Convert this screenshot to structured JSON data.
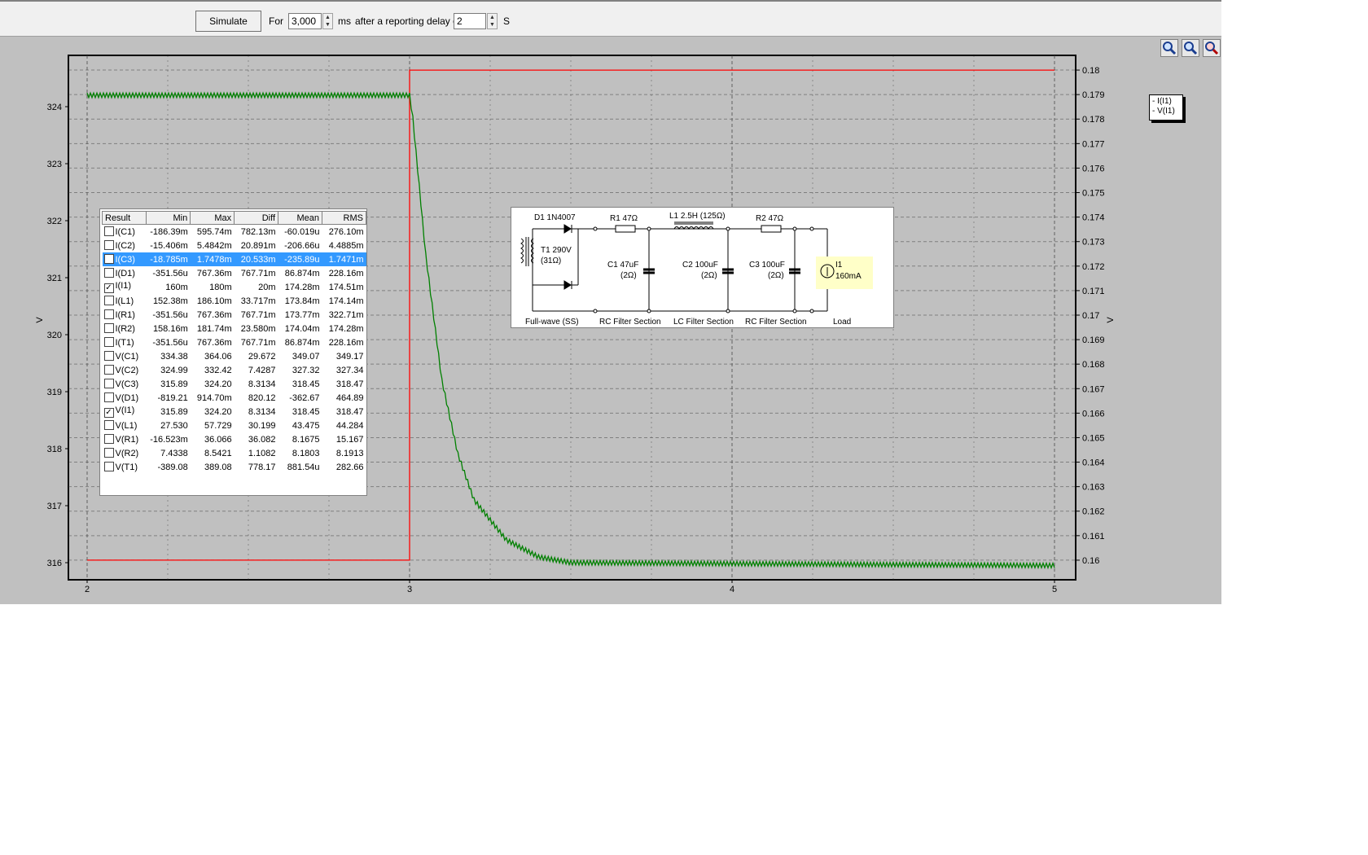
{
  "toolbar": {
    "simulate_label": "Simulate",
    "for_label": "For",
    "duration_value": "3,000",
    "ms_label": "ms",
    "delay_label": "after a reporting delay of",
    "delay_value": "2",
    "s_label": "S"
  },
  "zoom_icons": [
    "zoom-in-icon",
    "zoom-out-icon",
    "zoom-fit-icon"
  ],
  "legend": {
    "items": [
      "- I(I1)",
      "- V(I1)"
    ]
  },
  "table": {
    "headers": [
      "Result",
      "Min",
      "Max",
      "Diff",
      "Mean",
      "RMS"
    ],
    "rows": [
      {
        "name": "I(C1)",
        "checked": false,
        "selected": false,
        "min": "-186.39m",
        "max": "595.74m",
        "diff": "782.13m",
        "mean": "-60.019u",
        "rms": "276.10m"
      },
      {
        "name": "I(C2)",
        "checked": false,
        "selected": false,
        "min": "-15.406m",
        "max": "5.4842m",
        "diff": "20.891m",
        "mean": "-206.66u",
        "rms": "4.4885m"
      },
      {
        "name": "I(C3)",
        "checked": false,
        "selected": true,
        "min": "-18.785m",
        "max": "1.7478m",
        "diff": "20.533m",
        "mean": "-235.89u",
        "rms": "1.7471m"
      },
      {
        "name": "I(D1)",
        "checked": false,
        "selected": false,
        "min": "-351.56u",
        "max": "767.36m",
        "diff": "767.71m",
        "mean": "86.874m",
        "rms": "228.16m"
      },
      {
        "name": "I(I1)",
        "checked": true,
        "selected": false,
        "min": "160m",
        "max": "180m",
        "diff": "20m",
        "mean": "174.28m",
        "rms": "174.51m"
      },
      {
        "name": "I(L1)",
        "checked": false,
        "selected": false,
        "min": "152.38m",
        "max": "186.10m",
        "diff": "33.717m",
        "mean": "173.84m",
        "rms": "174.14m"
      },
      {
        "name": "I(R1)",
        "checked": false,
        "selected": false,
        "min": "-351.56u",
        "max": "767.36m",
        "diff": "767.71m",
        "mean": "173.77m",
        "rms": "322.71m"
      },
      {
        "name": "I(R2)",
        "checked": false,
        "selected": false,
        "min": "158.16m",
        "max": "181.74m",
        "diff": "23.580m",
        "mean": "174.04m",
        "rms": "174.28m"
      },
      {
        "name": "I(T1)",
        "checked": false,
        "selected": false,
        "min": "-351.56u",
        "max": "767.36m",
        "diff": "767.71m",
        "mean": "86.874m",
        "rms": "228.16m"
      },
      {
        "name": "V(C1)",
        "checked": false,
        "selected": false,
        "min": "334.38",
        "max": "364.06",
        "diff": "29.672",
        "mean": "349.07",
        "rms": "349.17"
      },
      {
        "name": "V(C2)",
        "checked": false,
        "selected": false,
        "min": "324.99",
        "max": "332.42",
        "diff": "7.4287",
        "mean": "327.32",
        "rms": "327.34"
      },
      {
        "name": "V(C3)",
        "checked": false,
        "selected": false,
        "min": "315.89",
        "max": "324.20",
        "diff": "8.3134",
        "mean": "318.45",
        "rms": "318.47"
      },
      {
        "name": "V(D1)",
        "checked": false,
        "selected": false,
        "min": "-819.21",
        "max": "914.70m",
        "diff": "820.12",
        "mean": "-362.67",
        "rms": "464.89"
      },
      {
        "name": "V(I1)",
        "checked": true,
        "selected": false,
        "min": "315.89",
        "max": "324.20",
        "diff": "8.3134",
        "mean": "318.45",
        "rms": "318.47"
      },
      {
        "name": "V(L1)",
        "checked": false,
        "selected": false,
        "min": "27.530",
        "max": "57.729",
        "diff": "30.199",
        "mean": "43.475",
        "rms": "44.284"
      },
      {
        "name": "V(R1)",
        "checked": false,
        "selected": false,
        "min": "-16.523m",
        "max": "36.066",
        "diff": "36.082",
        "mean": "8.1675",
        "rms": "15.167"
      },
      {
        "name": "V(R2)",
        "checked": false,
        "selected": false,
        "min": "7.4338",
        "max": "8.5421",
        "diff": "1.1082",
        "mean": "8.1803",
        "rms": "8.1913"
      },
      {
        "name": "V(T1)",
        "checked": false,
        "selected": false,
        "min": "-389.08",
        "max": "389.08",
        "diff": "778.17",
        "mean": "881.54u",
        "rms": "282.66"
      }
    ]
  },
  "schematic": {
    "d1": "D1 1N4007",
    "r1": "R1 47Ω",
    "l1": "L1 2.5H (125Ω)",
    "r2": "R2 47Ω",
    "t1a": "T1 290V",
    "t1b": "(31Ω)",
    "c1a": "C1 47uF",
    "c1b": "(2Ω)",
    "c2a": "C2 100uF",
    "c2b": "(2Ω)",
    "c3a": "C3 100uF",
    "c3b": "(2Ω)",
    "i1a": "I1",
    "i1b": "160mA",
    "sections": [
      "Full-wave (SS)",
      "RC Filter Section",
      "LC Filter Section",
      "RC Filter Section",
      "Load"
    ]
  },
  "chart_data": {
    "type": "line",
    "x_ticks": [
      "2",
      "3",
      "4",
      "5"
    ],
    "xlim": [
      2,
      5
    ],
    "y_left": {
      "label": "V",
      "ticks": [
        "316",
        "317",
        "318",
        "319",
        "320",
        "321",
        "322",
        "323",
        "324"
      ],
      "lim": [
        315.7,
        324.9
      ]
    },
    "y_right": {
      "label": "V",
      "ticks": [
        "0.16",
        "0.161",
        "0.162",
        "0.163",
        "0.164",
        "0.165",
        "0.166",
        "0.167",
        "0.168",
        "0.169",
        "0.17",
        "0.171",
        "0.172",
        "0.173",
        "0.174",
        "0.175",
        "0.176",
        "0.177",
        "0.178",
        "0.179",
        "0.18"
      ],
      "lim": [
        0.1592,
        0.1806
      ]
    },
    "grid": true,
    "series": [
      {
        "name": "I(I1)",
        "color": "#ff0000",
        "axis": "right",
        "points": [
          [
            2,
            0.16
          ],
          [
            3,
            0.16
          ],
          [
            3,
            0.18
          ],
          [
            5,
            0.18
          ]
        ]
      },
      {
        "name": "V(I1)",
        "color": "#008000",
        "axis": "left",
        "points": [
          [
            2,
            324.2
          ],
          [
            3,
            324.2
          ],
          [
            3.01,
            323.8
          ],
          [
            3.05,
            321.4
          ],
          [
            3.1,
            319.2
          ],
          [
            3.15,
            317.9
          ],
          [
            3.2,
            317.1
          ],
          [
            3.3,
            316.4
          ],
          [
            3.4,
            316.1
          ],
          [
            3.5,
            316.0
          ],
          [
            5,
            315.95
          ]
        ],
        "ripple": 0.04
      }
    ]
  }
}
